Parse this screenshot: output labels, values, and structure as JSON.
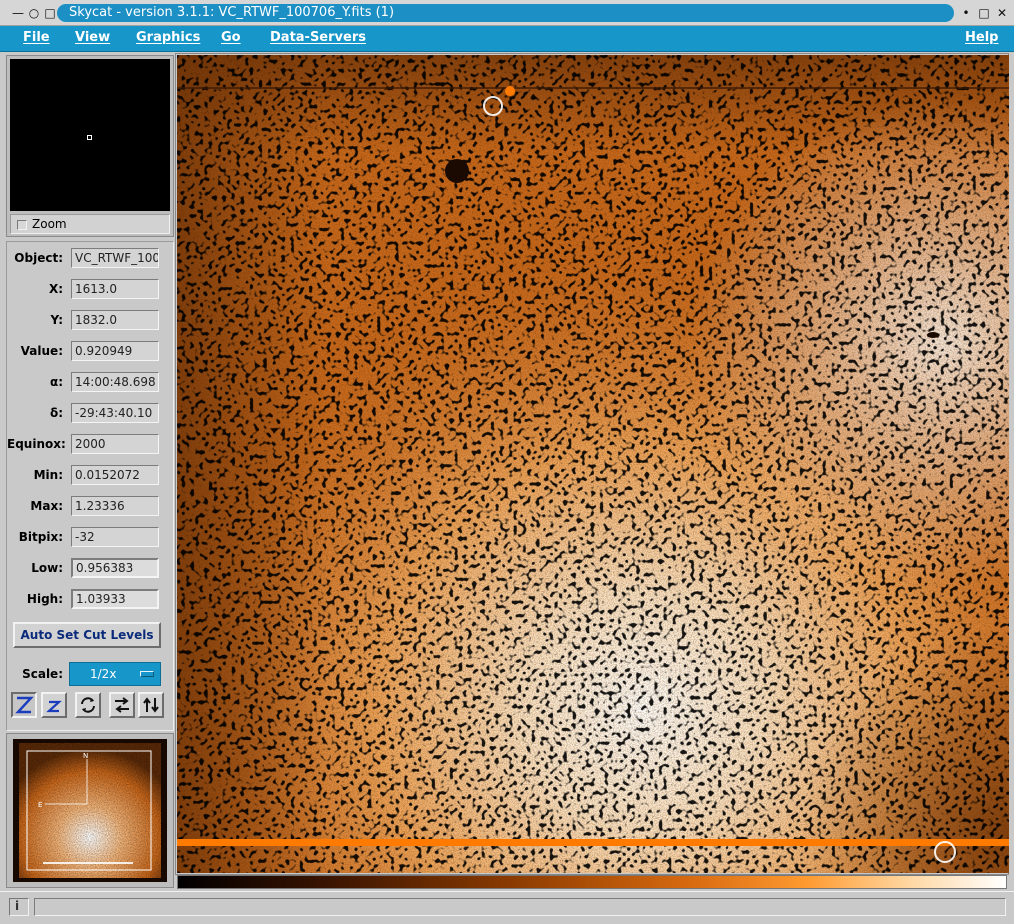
{
  "window": {
    "title": "Skycat - version 3.1.1: VC_RTWF_100706_Y.fits (1)"
  },
  "menubar": {
    "items": [
      {
        "label": "File"
      },
      {
        "label": "View"
      },
      {
        "label": "Graphics"
      },
      {
        "label": "Go"
      },
      {
        "label": "Data-Servers"
      },
      {
        "label": "Help"
      }
    ]
  },
  "zoom": {
    "label": "Zoom",
    "checked": false
  },
  "info": {
    "rows": [
      {
        "label": "Object:",
        "value": "VC_RTWF_100",
        "editable": false
      },
      {
        "label": "X:",
        "value": "1613.0",
        "editable": false
      },
      {
        "label": "Y:",
        "value": "1832.0",
        "editable": false
      },
      {
        "label": "Value:",
        "value": "0.920949",
        "editable": false
      },
      {
        "label": "α:",
        "value": "14:00:48.698",
        "editable": false
      },
      {
        "label": "δ:",
        "value": "-29:43:40.10",
        "editable": false
      },
      {
        "label": "Equinox:",
        "value": "2000",
        "editable": false
      },
      {
        "label": "Min:",
        "value": "0.0152072",
        "editable": false
      },
      {
        "label": "Max:",
        "value": "1.23336",
        "editable": false
      },
      {
        "label": "Bitpix:",
        "value": "-32",
        "editable": false
      },
      {
        "label": "Low:",
        "value": "0.956383",
        "editable": true
      },
      {
        "label": "High:",
        "value": "1.03933",
        "editable": true
      }
    ],
    "auto_cut_label": "Auto Set Cut Levels",
    "scale_label": "Scale:",
    "scale_value": "1/2x"
  },
  "toolbar": {
    "buttons": [
      {
        "name": "zoom-in-button",
        "glyph": "Z"
      },
      {
        "name": "zoom-out-button",
        "glyph": "z"
      },
      {
        "name": "rotate-button",
        "glyph": "rotate"
      },
      {
        "name": "flip-x-button",
        "glyph": "flip-x"
      },
      {
        "name": "flip-y-button",
        "glyph": "flip-y"
      }
    ]
  },
  "colors": {
    "accent": "#1796c9",
    "title_pill": "#1c8fc4",
    "image_base": "#c8661a",
    "image_highlight": "#ffffff",
    "image_stripe": "#ff7a00"
  },
  "statusbar": {
    "icon": "info-icon",
    "icon_glyph": "i"
  }
}
